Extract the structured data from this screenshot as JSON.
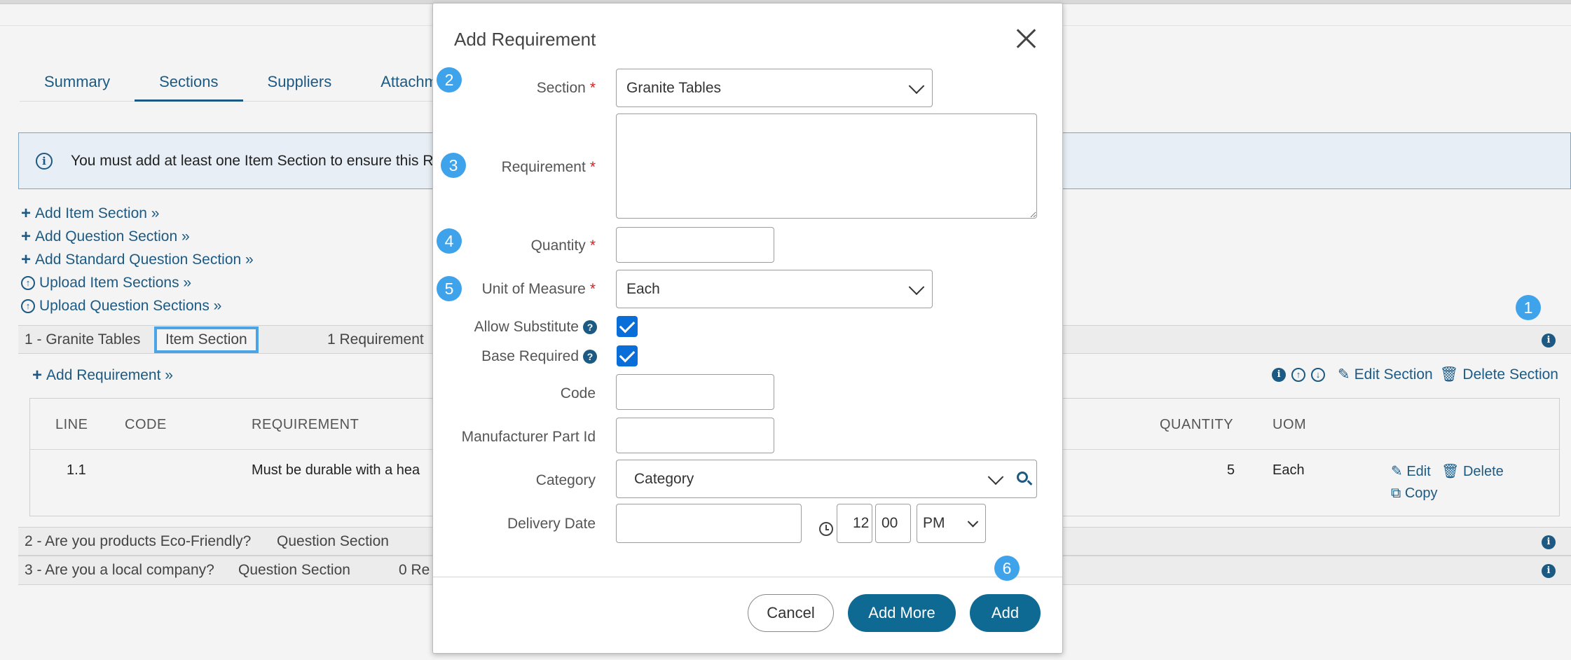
{
  "tabs": [
    "Summary",
    "Sections",
    "Suppliers",
    "Attachm"
  ],
  "info_banner": {
    "icon": "info-icon",
    "text": "You must add at least one Item Section to ensure this R"
  },
  "links": [
    {
      "icon": "plus-icon",
      "label": "Add Item Section »"
    },
    {
      "icon": "plus-icon",
      "label": "Add Question Section »"
    },
    {
      "icon": "plus-icon",
      "label": "Add Standard Question Section »"
    },
    {
      "icon": "upload-icon",
      "label": "Upload Item Sections »"
    },
    {
      "icon": "upload-icon",
      "label": "Upload Question Sections »"
    }
  ],
  "sections": [
    {
      "title": "1 - Granite Tables",
      "type": "Item Section",
      "count": "1 Requirement"
    },
    {
      "title": "2 - Are you products Eco-Friendly?",
      "type": "Question Section",
      "count": ""
    },
    {
      "title": "3 - Are you a local company?",
      "type": "Question Section",
      "count": "0 Re"
    }
  ],
  "section_actions": {
    "add_requirement": "Add Requirement »",
    "edit": "Edit Section",
    "delete": "Delete Section"
  },
  "table": {
    "headers": {
      "line": "LINE",
      "code": "CODE",
      "requirement": "REQUIREMENT",
      "quantity": "QUANTITY",
      "uom": "UOM"
    },
    "row": {
      "line": "1.1",
      "code": "",
      "requirement": "Must be durable with a hea",
      "quantity": "5",
      "uom": "Each",
      "edit": "Edit",
      "delete": "Delete",
      "copy": "Copy"
    }
  },
  "markers": [
    "1",
    "2",
    "3",
    "4",
    "5",
    "6"
  ],
  "modal": {
    "title": "Add Requirement",
    "labels": {
      "section": "Section",
      "requirement": "Requirement",
      "quantity": "Quantity",
      "uom": "Unit of Measure",
      "allow_substitute": "Allow Substitute",
      "base_required": "Base Required",
      "code": "Code",
      "mfr_part_id": "Manufacturer Part Id",
      "category": "Category",
      "delivery_date": "Delivery Date"
    },
    "required_mark": "*",
    "values": {
      "section": "Granite Tables",
      "uom": "Each",
      "category_placeholder": "Category",
      "hour": "12",
      "minute": "00",
      "ampm": "PM"
    },
    "checks": {
      "allow_substitute": true,
      "base_required": true
    },
    "buttons": {
      "cancel": "Cancel",
      "add_more": "Add More",
      "add": "Add"
    }
  },
  "colors": {
    "accent": "#1d5a83",
    "primary_button": "#0f6a93",
    "marker": "#3ea3ea",
    "required": "#d61f1f",
    "checkbox": "#0a6ed8"
  }
}
